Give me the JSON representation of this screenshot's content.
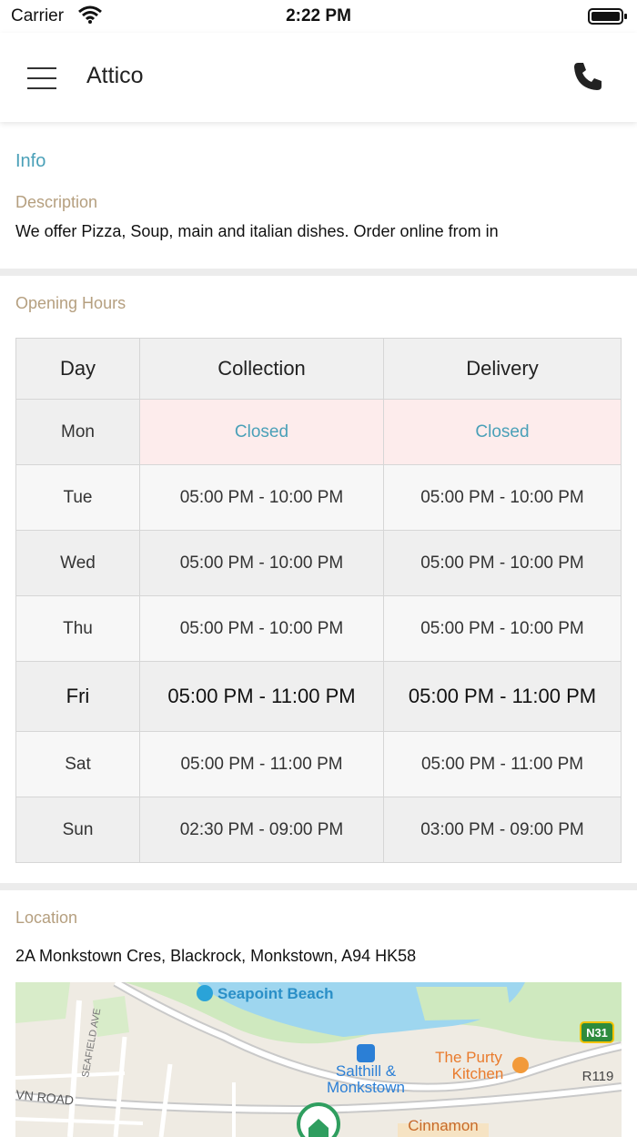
{
  "status_bar": {
    "carrier": "Carrier",
    "time": "2:22 PM",
    "icons": [
      "wifi-icon",
      "battery-icon"
    ]
  },
  "app_bar": {
    "title": "Attico",
    "icons": [
      "menu-icon",
      "phone-icon"
    ]
  },
  "info": {
    "section_title": "Info",
    "description_label": "Description",
    "description_text": "We offer Pizza, Soup, main and italian dishes. Order online from  in"
  },
  "opening_hours": {
    "label": "Opening Hours",
    "columns": [
      "Day",
      "Collection",
      "Delivery"
    ],
    "rows": [
      {
        "day": "Mon",
        "collection": "Closed",
        "delivery": "Closed"
      },
      {
        "day": "Tue",
        "collection": "05:00 PM - 10:00 PM",
        "delivery": "05:00 PM - 10:00 PM"
      },
      {
        "day": "Wed",
        "collection": "05:00 PM - 10:00 PM",
        "delivery": "05:00 PM - 10:00 PM"
      },
      {
        "day": "Thu",
        "collection": "05:00 PM - 10:00 PM",
        "delivery": "05:00 PM - 10:00 PM"
      },
      {
        "day": "Fri",
        "collection": "05:00 PM - 11:00 PM",
        "delivery": "05:00 PM - 11:00 PM"
      },
      {
        "day": "Sat",
        "collection": "05:00 PM - 11:00 PM",
        "delivery": "05:00 PM - 11:00 PM"
      },
      {
        "day": "Sun",
        "collection": "02:30 PM - 09:00 PM",
        "delivery": "03:00 PM - 09:00 PM"
      }
    ],
    "highlighted_day": "Fri",
    "closed_color": "#fdecec"
  },
  "location": {
    "label": "Location",
    "address": "2A Monkstown Cres, Blackrock, Monkstown, A94 HK58",
    "map_labels": {
      "beach": "Seapoint Beach",
      "station_line1": "Salthill &",
      "station_line2": "Monkstown",
      "restaurant_line1": "The Purty",
      "restaurant_line2": "Kitchen",
      "road_n31": "N31",
      "road_r119": "R119",
      "street_seafield": "SEAFIELD AVE",
      "street_road": "VN ROAD",
      "cinnamon": "Cinnamon"
    }
  },
  "colors": {
    "accent": "#4aa0b8",
    "label": "#b59f7f",
    "divider": "#ececec"
  }
}
